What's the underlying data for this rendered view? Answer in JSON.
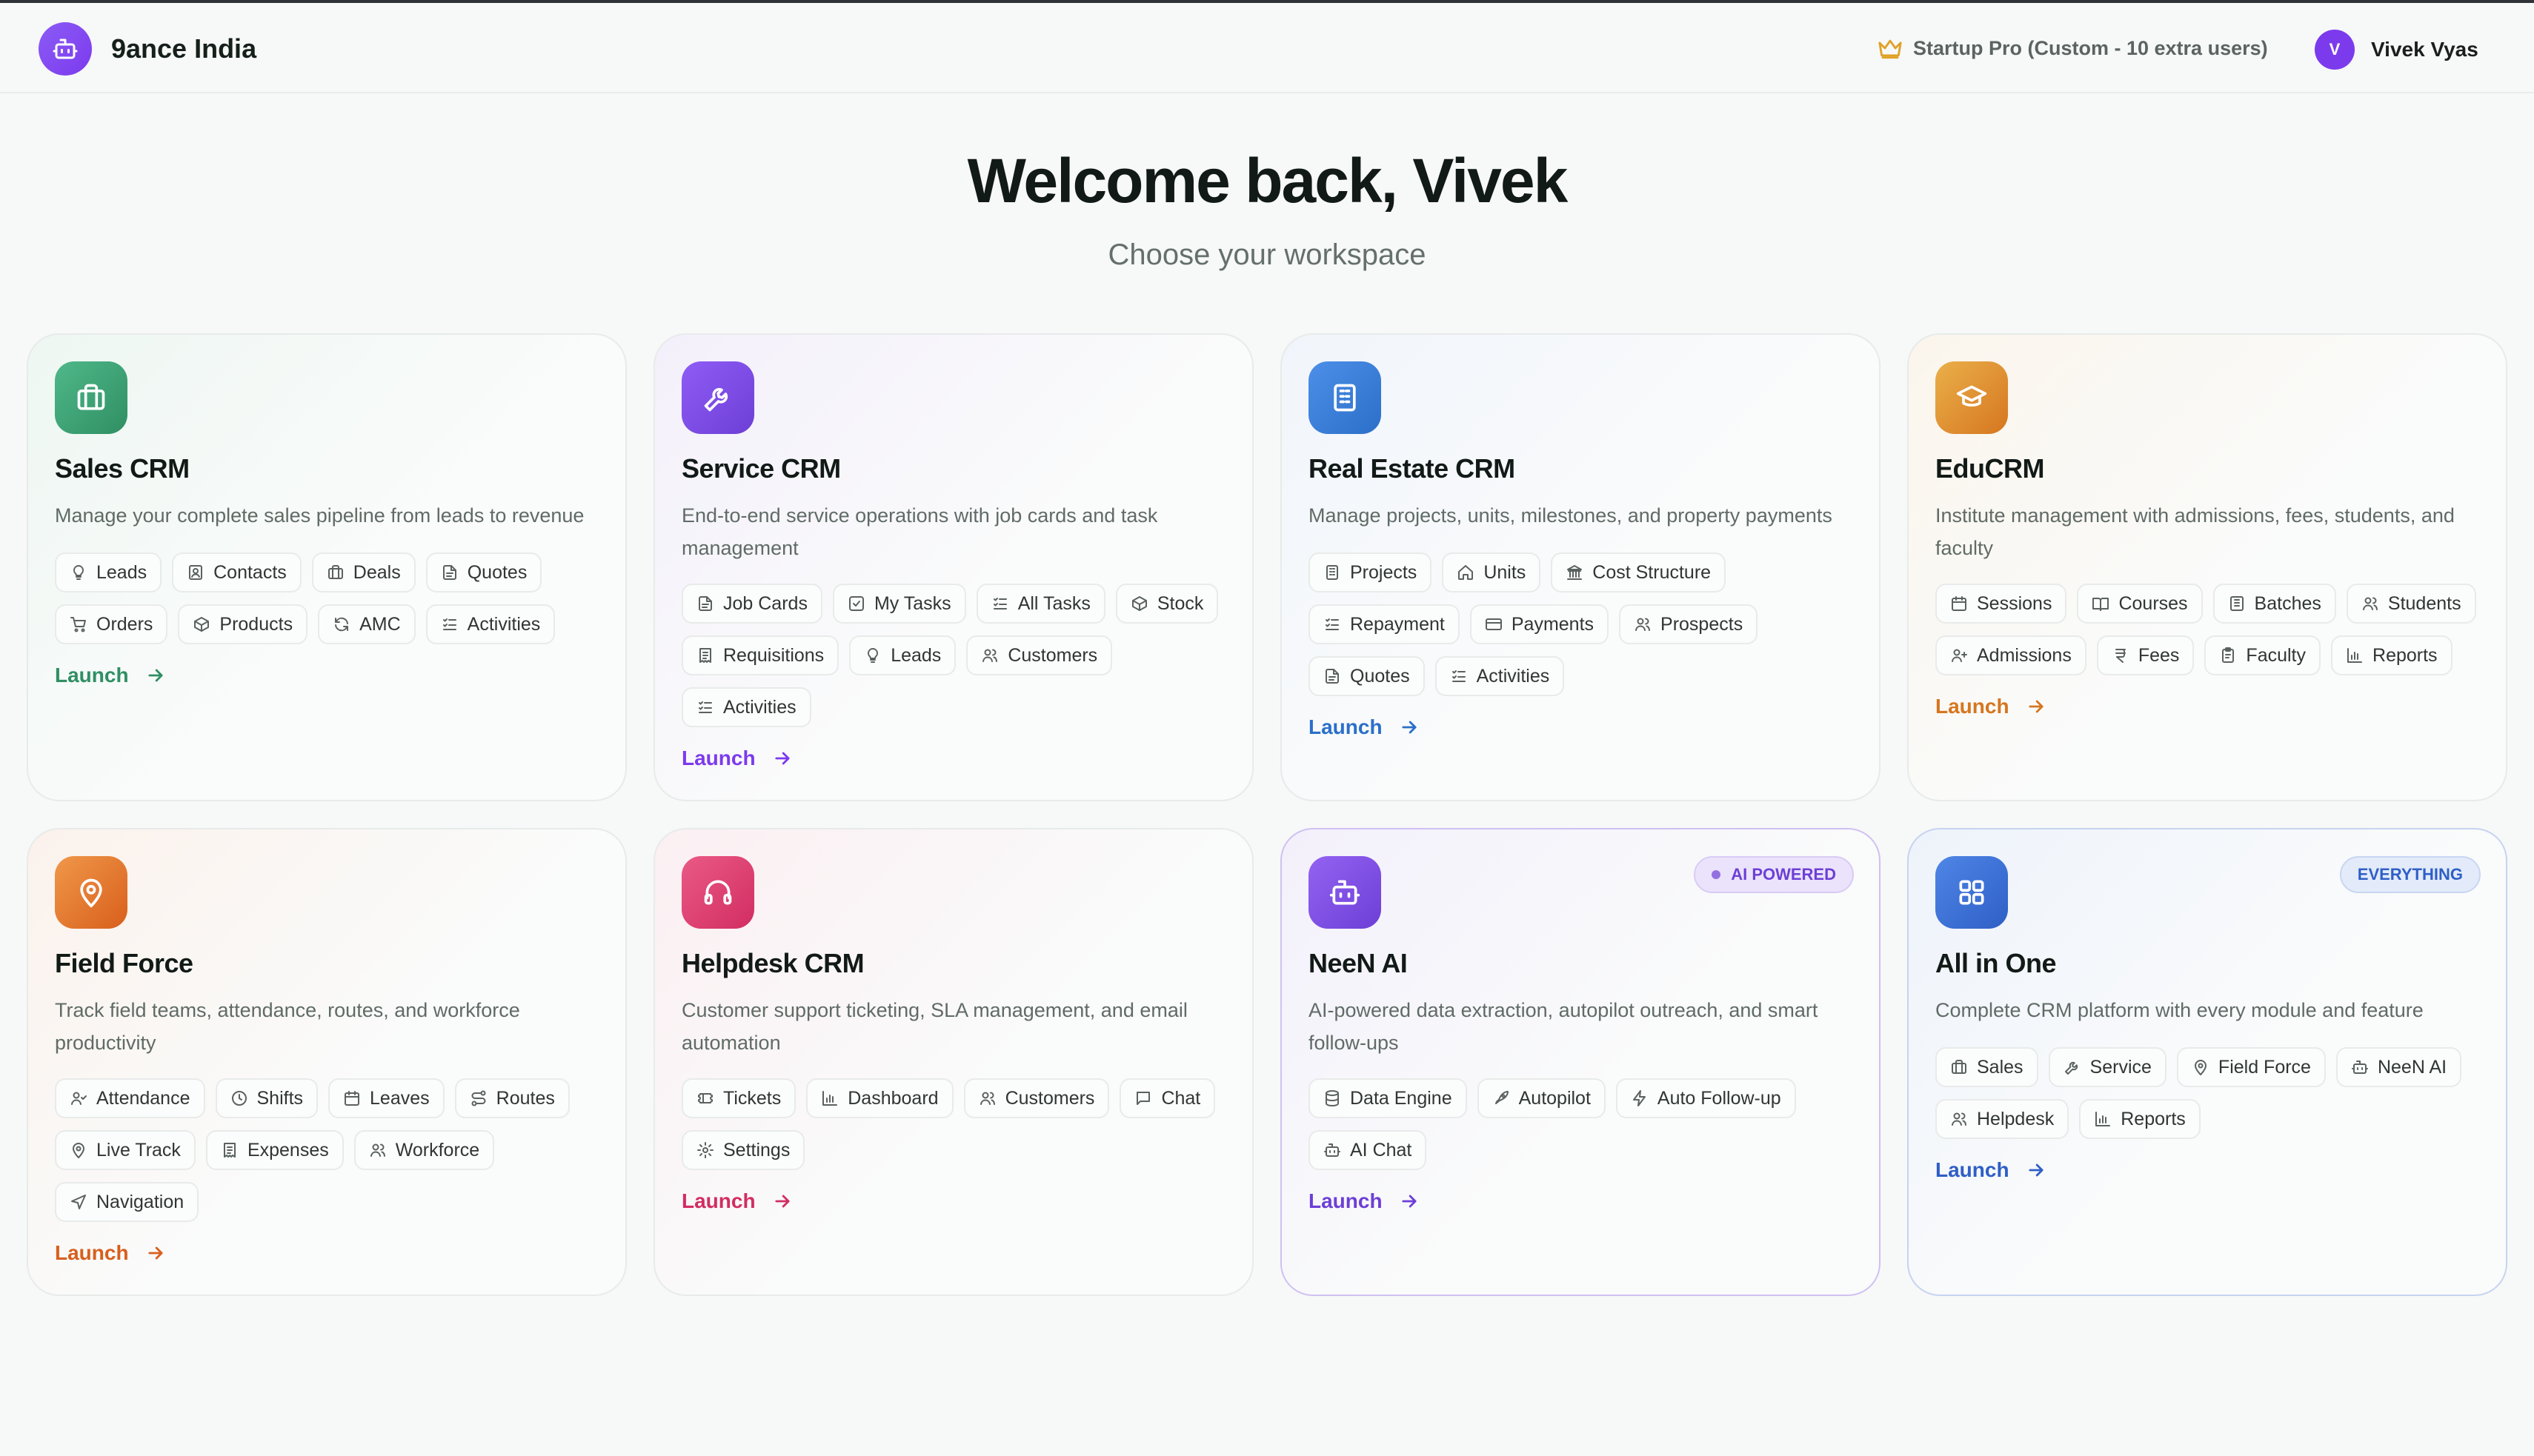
{
  "header": {
    "brand_name": "9ance India",
    "plan_label": "Startup Pro (Custom - 10 extra users)",
    "user_initial": "V",
    "user_name": "Vivek Vyas"
  },
  "hero": {
    "title": "Welcome back, Vivek",
    "subtitle": "Choose your workspace"
  },
  "colors": {
    "sales": "#2f8f63",
    "service": "#7c3aed",
    "realestate": "#2b6fc9",
    "edu": "#d6761f",
    "field": "#d85f1c",
    "helpdesk": "#d22d62",
    "neen": "#6d3fd6",
    "allinone": "#2f5fc6"
  },
  "cards": [
    {
      "title": "Sales CRM",
      "description": "Manage your complete sales pipeline from leads to revenue",
      "icon": "briefcase-icon",
      "launch": "Launch",
      "chips": [
        "Leads",
        "Contacts",
        "Deals",
        "Quotes",
        "Orders",
        "Products",
        "AMC",
        "Activities"
      ]
    },
    {
      "title": "Service CRM",
      "description": "End-to-end service operations with job cards and task management",
      "icon": "wrench-icon",
      "launch": "Launch",
      "chips": [
        "Job Cards",
        "My Tasks",
        "All Tasks",
        "Stock",
        "Requisitions",
        "Leads",
        "Customers",
        "Activities"
      ]
    },
    {
      "title": "Real Estate CRM",
      "description": "Manage projects, units, milestones, and property payments",
      "icon": "building-icon",
      "launch": "Launch",
      "chips": [
        "Projects",
        "Units",
        "Cost Structure",
        "Repayment",
        "Payments",
        "Prospects",
        "Quotes",
        "Activities"
      ]
    },
    {
      "title": "EduCRM",
      "description": "Institute management with admissions, fees, students, and faculty",
      "icon": "graduation-cap-icon",
      "launch": "Launch",
      "chips": [
        "Sessions",
        "Courses",
        "Batches",
        "Students",
        "Admissions",
        "Fees",
        "Faculty",
        "Reports"
      ]
    },
    {
      "title": "Field Force",
      "description": "Track field teams, attendance, routes, and workforce productivity",
      "icon": "map-pin-icon",
      "launch": "Launch",
      "chips": [
        "Attendance",
        "Shifts",
        "Leaves",
        "Routes",
        "Live Track",
        "Expenses",
        "Workforce",
        "Navigation"
      ]
    },
    {
      "title": "Helpdesk CRM",
      "description": "Customer support ticketing, SLA management, and email automation",
      "icon": "headphones-icon",
      "launch": "Launch",
      "chips": [
        "Tickets",
        "Dashboard",
        "Customers",
        "Chat",
        "Settings"
      ]
    },
    {
      "title": "NeeN AI",
      "description": "AI-powered data extraction, autopilot outreach, and smart follow-ups",
      "icon": "bot-icon",
      "badge": "AI POWERED",
      "launch": "Launch",
      "chips": [
        "Data Engine",
        "Autopilot",
        "Auto Follow-up",
        "AI Chat"
      ]
    },
    {
      "title": "All in One",
      "description": "Complete CRM platform with every module and feature",
      "icon": "grid-icon",
      "badge": "EVERYTHING",
      "launch": "Launch",
      "chips": [
        "Sales",
        "Service",
        "Field Force",
        "NeeN AI",
        "Helpdesk",
        "Reports"
      ]
    }
  ]
}
